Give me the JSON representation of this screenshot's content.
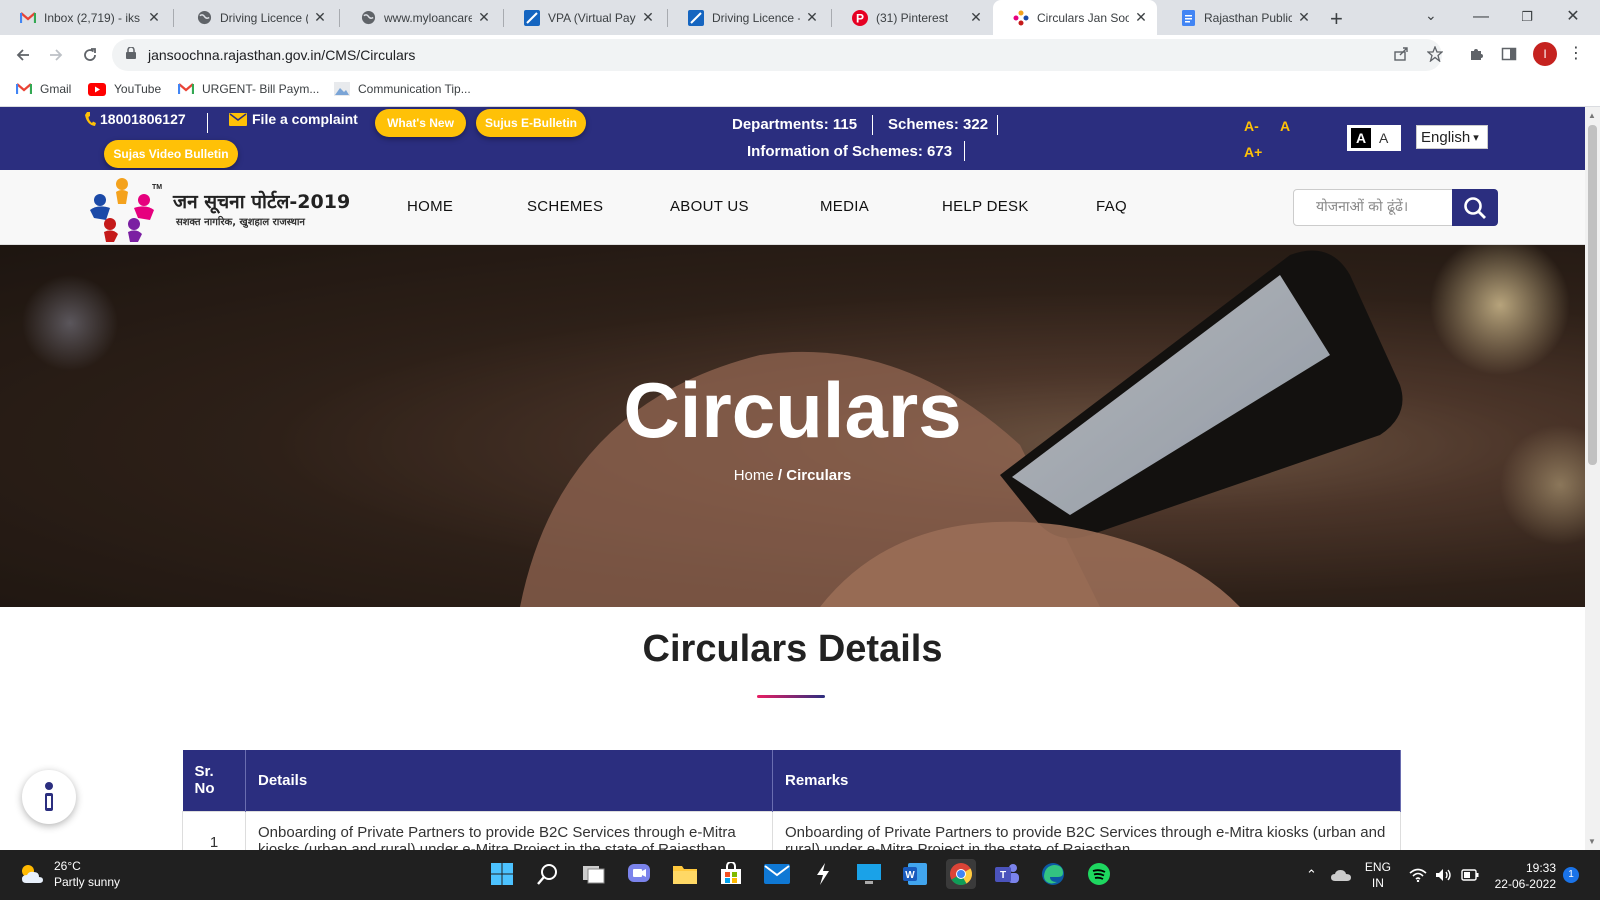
{
  "browser": {
    "tabs": [
      {
        "title": "Inbox (2,719) - iks",
        "icon": "gmail-icon"
      },
      {
        "title": "Driving Licence (D",
        "icon": "globe-icon"
      },
      {
        "title": "www.myloancare.",
        "icon": "globe-icon"
      },
      {
        "title": "VPA (Virtual Paym",
        "icon": "z-icon"
      },
      {
        "title": "Driving Licence - ",
        "icon": "z-icon"
      },
      {
        "title": "(31) Pinterest",
        "icon": "pinterest-icon"
      },
      {
        "title": "Circulars Jan Soo",
        "icon": "jansoochna-icon"
      },
      {
        "title": "Rajasthan Public ",
        "icon": "docs-icon"
      }
    ],
    "active_tab_index": 6,
    "url": "jansoochna.rajasthan.gov.in/CMS/Circulars",
    "profile_initial": "I",
    "bookmarks": [
      {
        "label": "Gmail",
        "icon": "gmail-icon"
      },
      {
        "label": "YouTube",
        "icon": "youtube-icon"
      },
      {
        "label": "URGENT- Bill Paym...",
        "icon": "gmail-icon"
      },
      {
        "label": "Communication Tip...",
        "icon": "image-icon"
      }
    ]
  },
  "site": {
    "phone": "18001806127",
    "complaint": "File a complaint",
    "whats_new": "What's New",
    "e_bulletin": "Sujus E-Bulletin",
    "video_bulletin": "Sujas Video Bulletin",
    "departments": "Departments: 115",
    "schemes": "Schemes: 322",
    "info_schemes": "Information of Schemes: 673",
    "font_minus": "A-",
    "font_normal": "A",
    "font_plus": "A+",
    "contrast_dark": "A",
    "contrast_light": "A",
    "language": "English",
    "logo_title": "जन सूचना पोर्टल-2019",
    "logo_subtitle": "सशक्त नागरिक, खुशहाल राजस्थान",
    "logo_tm": "TM",
    "nav": [
      "HOME",
      "SCHEMES",
      "ABOUT US",
      "MEDIA",
      "HELP DESK",
      "FAQ"
    ],
    "search_placeholder": "योजनाओं को ढूंढें।",
    "hero_title": "Circulars",
    "breadcrumb_home": "Home",
    "breadcrumb_sep": " / ",
    "breadcrumb_current": "Circulars",
    "section_title": "Circulars Details",
    "table": {
      "headers": [
        "Sr. No",
        "Details",
        "Remarks"
      ],
      "rows": [
        [
          "1",
          "Onboarding of Private Partners to provide B2C Services through e-Mitra kiosks (urban and rural) under e-Mitra Project in the state of Rajasthan",
          "Onboarding of Private Partners to provide B2C Services through e-Mitra kiosks (urban and rural) under e-Mitra Project in the state of Rajasthan"
        ]
      ]
    },
    "colors": {
      "primary": "#2b2e7f",
      "accent": "#ffc107"
    }
  },
  "taskbar": {
    "weather_temp": "26°C",
    "weather_desc": "Partly sunny",
    "lang_top": "ENG",
    "lang_bottom": "IN",
    "time": "19:33",
    "date": "22-06-2022",
    "notifications": "1"
  }
}
